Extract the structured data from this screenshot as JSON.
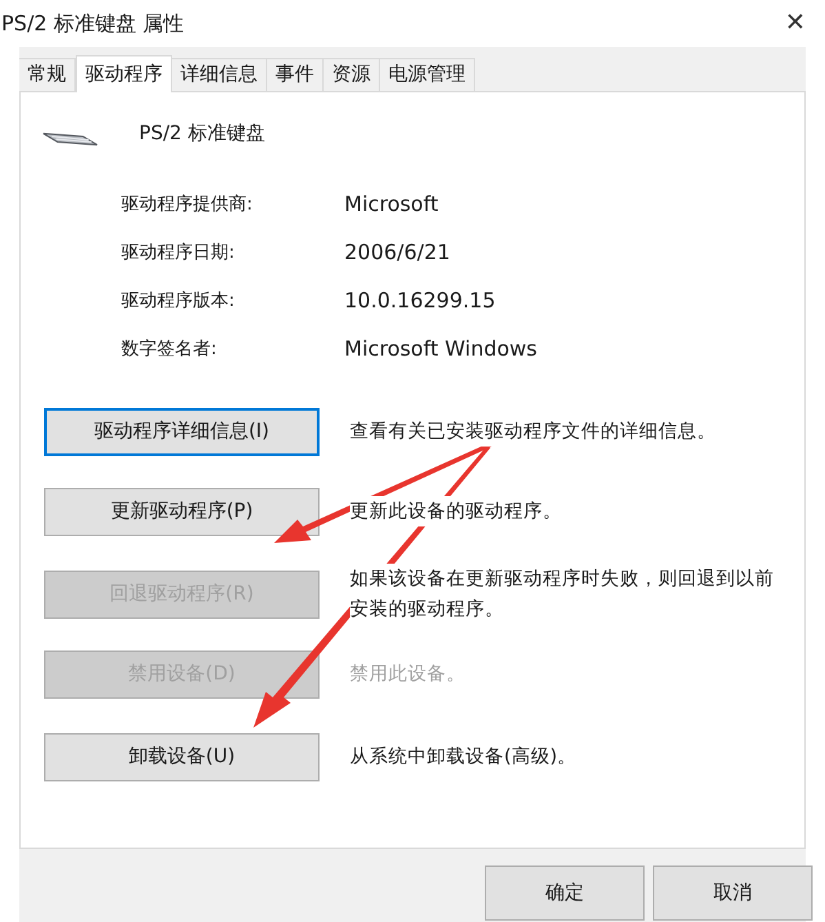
{
  "window": {
    "title": "PS/2 标准键盘 属性",
    "close": "✕"
  },
  "tabs": [
    {
      "label": "常规",
      "selected": false
    },
    {
      "label": "驱动程序",
      "selected": true
    },
    {
      "label": "详细信息",
      "selected": false
    },
    {
      "label": "事件",
      "selected": false
    },
    {
      "label": "资源",
      "selected": false
    },
    {
      "label": "电源管理",
      "selected": false
    }
  ],
  "device": {
    "name": "PS/2 标准键盘"
  },
  "properties": [
    {
      "label": "驱动程序提供商:",
      "value": "Microsoft"
    },
    {
      "label": "驱动程序日期:",
      "value": "2006/6/21"
    },
    {
      "label": "驱动程序版本:",
      "value": "10.0.16299.15"
    },
    {
      "label": "数字签名者:",
      "value": "Microsoft Windows"
    }
  ],
  "actions": [
    {
      "label": "驱动程序详细信息(I)",
      "description": "查看有关已安装驱动程序文件的详细信息。",
      "disabled": false,
      "focused": true
    },
    {
      "label": "更新驱动程序(P)",
      "description": "更新此设备的驱动程序。",
      "disabled": false,
      "focused": false
    },
    {
      "label": "回退驱动程序(R)",
      "description": "如果该设备在更新驱动程序时失败，则回退到以前安装的驱动程序。",
      "disabled": true,
      "focused": false
    },
    {
      "label": "禁用设备(D)",
      "description": "禁用此设备。",
      "disabled": true,
      "focused": false
    },
    {
      "label": "卸载设备(U)",
      "description": "从系统中卸载设备(高级)。",
      "disabled": false,
      "focused": false
    }
  ],
  "footer_buttons": [
    "确定",
    "取消"
  ]
}
